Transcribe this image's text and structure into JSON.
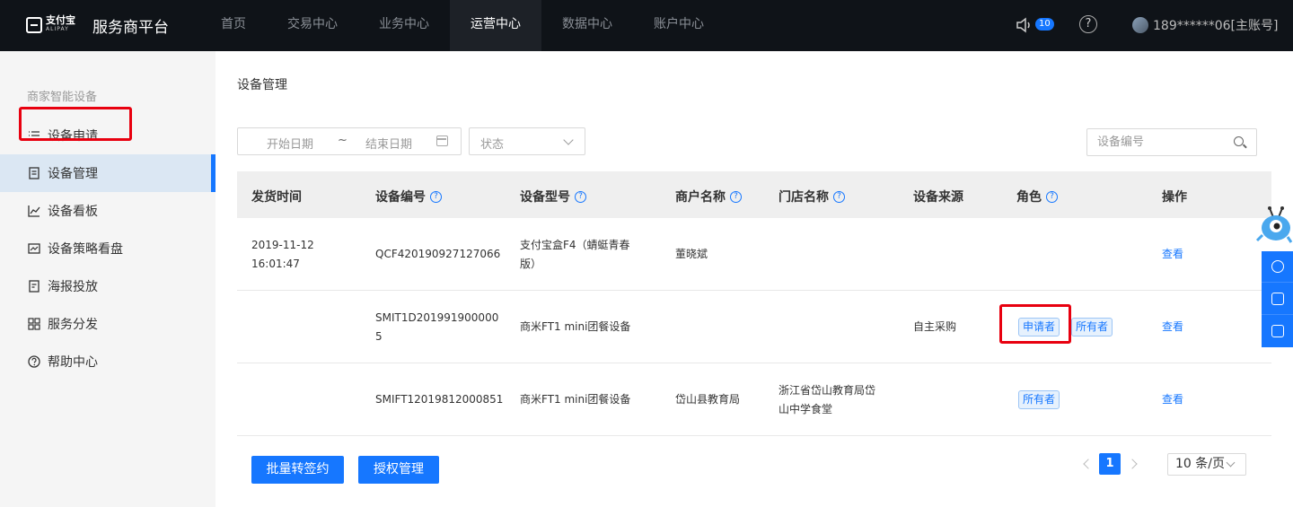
{
  "header": {
    "logo_cn": "支付宝",
    "logo_en": "ALIPAY",
    "platform_title": "服务商平台",
    "nav": [
      "首页",
      "交易中心",
      "业务中心",
      "运营中心",
      "数据中心",
      "账户中心"
    ],
    "active_nav": "运营中心",
    "notification_count": "10",
    "help_symbol": "?",
    "account": "189******06[主账号]"
  },
  "sidebar": {
    "group": "商家智能设备",
    "items": [
      {
        "label": "设备申请",
        "icon": "list-icon"
      },
      {
        "label": "设备管理",
        "icon": "document-icon"
      },
      {
        "label": "设备看板",
        "icon": "line-chart-icon"
      },
      {
        "label": "设备策略看盘",
        "icon": "chart-box-icon"
      },
      {
        "label": "海报投放",
        "icon": "poster-icon"
      },
      {
        "label": "服务分发",
        "icon": "grid-icon"
      },
      {
        "label": "帮助中心",
        "icon": "help-circle-icon"
      }
    ],
    "active_item": "设备管理"
  },
  "main": {
    "title": "设备管理",
    "filters": {
      "date_start_placeholder": "开始日期",
      "date_separator": "~",
      "date_end_placeholder": "结束日期",
      "status_placeholder": "状态",
      "search_placeholder": "设备编号"
    },
    "table": {
      "columns": [
        "发货时间",
        "设备编号",
        "设备型号",
        "商户名称",
        "门店名称",
        "设备来源",
        "角色",
        "操作"
      ],
      "columns_with_help": [
        "设备编号",
        "设备型号",
        "商户名称",
        "门店名称",
        "角色"
      ],
      "rows": [
        {
          "ship_time": [
            "2019-11-12",
            "16:01:47"
          ],
          "device_id": [
            "QCF420190927127066"
          ],
          "model": [
            "支付宝盒F4（蜻蜓青春",
            "版）"
          ],
          "merchant": "董晓斌",
          "store": [],
          "source": "",
          "roles": [],
          "action": "查看"
        },
        {
          "ship_time": [],
          "device_id": [
            "SMIT1D201991900000",
            "5"
          ],
          "model": [
            "商米FT1 mini团餐设备"
          ],
          "merchant": "",
          "store": [],
          "source": "自主采购",
          "roles": [
            "申请者",
            "所有者"
          ],
          "action": "查看"
        },
        {
          "ship_time": [],
          "device_id": [
            "SMIFT12019812000851"
          ],
          "model": [
            "商米FT1 mini团餐设备"
          ],
          "merchant": "岱山县教育局",
          "store": [
            "浙江省岱山教育局岱",
            "山中学食堂"
          ],
          "source": "",
          "roles": [
            "所有者"
          ],
          "action": "查看"
        }
      ]
    },
    "buttons": {
      "batch_transfer": "批量转签约",
      "authorization": "授权管理"
    },
    "pagination": {
      "current_page": "1",
      "page_size": "10 条/页"
    }
  },
  "colors": {
    "topbar_bg": "#0f1318",
    "primary": "#1677ff",
    "highlight_border": "#e8000f",
    "sidebar_bg": "#f5f5f5",
    "sidebar_active_bg": "#dbe7f3"
  }
}
